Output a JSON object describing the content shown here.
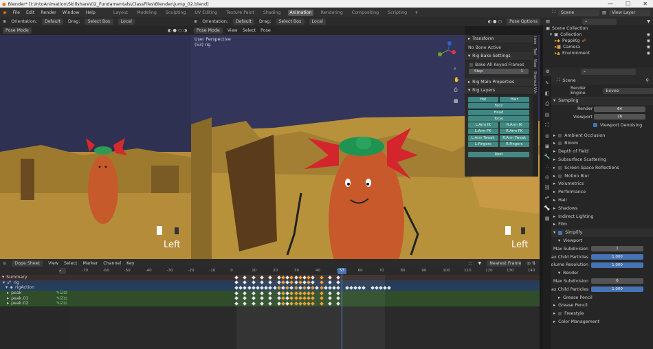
{
  "title_bar": {
    "title": "Blender* [I:\\IntoAnimation\\Skillshare\\02_Fundamentals\\ClassFiles\\Blender\\jump_02.blend]",
    "min": "—",
    "max": "☐",
    "close": "✕"
  },
  "menu": [
    "File",
    "Edit",
    "Render",
    "Window",
    "Help"
  ],
  "workspaces": [
    "Layout",
    "Modeling",
    "Sculpting",
    "UV Editing",
    "Texture Paint",
    "Shading",
    "Animation",
    "Rendering",
    "Compositing",
    "Scripting"
  ],
  "active_workspace": "Animation",
  "scene_field": "Scene",
  "view_layer_field": "View Layer",
  "left_header": {
    "orientation": "Orientation:",
    "orient_val": "Default",
    "drag": "Drag:",
    "select": "Select Box",
    "local": "Local",
    "mode": "Pose Mode"
  },
  "main_header": {
    "orientation": "Orientation:",
    "orient_val": "Default",
    "drag": "Drag:",
    "select": "Select Box",
    "local": "Local",
    "mode": "Pose Mode",
    "menus": [
      "View",
      "Select",
      "Pose"
    ],
    "pose_options": "Pose Options"
  },
  "viewport_left": {
    "label": "Left"
  },
  "viewport_main": {
    "perspective": "User Perspective",
    "object": "(53) rig",
    "label": "Left"
  },
  "n_panel": {
    "transform": "Transform",
    "no_bone": "No Bone Active",
    "bake_settings": "Rig Bake Settings",
    "bake_all": "Bake All Keyed Frames",
    "step": "Step",
    "step_val": "1",
    "main_props": "Rig Main Properties",
    "layers": "Rig Layers",
    "layer_buttons": [
      [
        "Hat",
        "Hair"
      ],
      [
        "Face"
      ],
      [
        "Head"
      ],
      [
        "Torso"
      ],
      [
        "L.Arm IK",
        "R.Arm IK"
      ],
      [
        "L.Arm FK",
        "R.Arm FK"
      ],
      [
        "L.Arm Tweak",
        "R.Arm Tweak"
      ],
      [
        "L.Fingers",
        "R.Fingers"
      ]
    ],
    "root": "Root"
  },
  "side_tabs": [
    "Item",
    "Tool",
    "View",
    "Shortcut VUr"
  ],
  "outliner": {
    "scene_collection": "Scene Collection",
    "items": [
      "Collection",
      "PoppiKg",
      "Camera",
      "Environment"
    ]
  },
  "properties": {
    "scene": "Scene",
    "render_engine_label": "Render Engine",
    "render_engine": "Eevee",
    "sampling": "Sampling",
    "render_label": "Render",
    "render_val": "64",
    "viewport_label": "Viewport",
    "viewport_val": "16",
    "viewport_denoising": "Viewport Denoising",
    "panels": [
      "Ambient Occlusion",
      "Bloom",
      "Depth of Field",
      "Subsurface Scattering",
      "Screen Space Reflections",
      "Motion Blur",
      "Volumetrics",
      "Performance",
      "Hair",
      "Shadows",
      "Indirect Lighting",
      "Film"
    ],
    "simplify": "Simplify",
    "viewport_sub": "Viewport",
    "max_subdiv": "Max Subdivision",
    "max_subdiv_val": "1",
    "max_child": "Max Child Particles",
    "max_child_val": "1.000",
    "volume_res": "Volume Resolution",
    "volume_res_val": "1.000",
    "render_sub": "Render",
    "r_max_subdiv": "Max Subdivision",
    "r_max_subdiv_val": "6",
    "r_max_child": "Max Child Particles",
    "r_max_child_val": "1.000",
    "grease_pencil_sub": "Grease Pencil",
    "panels2": [
      "Grease Pencil",
      "Freestyle",
      "Color Management"
    ]
  },
  "dope": {
    "editor": "Dope Sheet",
    "menus": [
      "View",
      "Select",
      "Marker",
      "Channel",
      "Key"
    ],
    "snap": "Nearest Frame",
    "current_frame": "53",
    "ruler": [
      "-70",
      "-60",
      "-50",
      "-40",
      "-30",
      "-20",
      "-10",
      "0",
      "10",
      "20",
      "30",
      "40",
      "50",
      "60",
      "70",
      "80",
      "90",
      "100",
      "110",
      "120",
      "130",
      "140"
    ],
    "channels": [
      "Summary",
      "rig",
      "rigAction",
      "peak",
      "peak.01",
      "peak.02"
    ]
  },
  "colors": {
    "accent": "#4772b3",
    "teal": "#3e8a86",
    "keyframe": "#f0a030"
  }
}
